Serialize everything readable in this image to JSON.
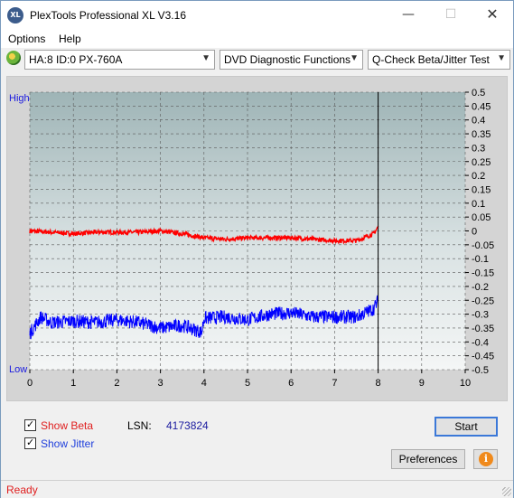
{
  "window": {
    "title": "PlexTools Professional XL V3.16",
    "icon": "XL"
  },
  "controls": {
    "minimize": "—",
    "maximize": "☐",
    "close": "✕"
  },
  "menu": {
    "options": "Options",
    "help": "Help"
  },
  "toolbar": {
    "drive": "HA:8 ID:0  PX-760A",
    "function": "DVD Diagnostic Functions",
    "test": "Q-Check Beta/Jitter Test"
  },
  "chart_data": {
    "type": "line",
    "left_labels": {
      "high": "High",
      "low": "Low"
    },
    "x_ticks": [
      "0",
      "1",
      "2",
      "3",
      "4",
      "5",
      "6",
      "7",
      "8",
      "9",
      "10"
    ],
    "xlim": [
      0,
      10
    ],
    "y_ticks_right": [
      "0.5",
      "0.45",
      "0.4",
      "0.35",
      "0.3",
      "0.25",
      "0.2",
      "0.15",
      "0.1",
      "0.05",
      "0",
      "-0.05",
      "-0.1",
      "-0.15",
      "-0.2",
      "-0.25",
      "-0.3",
      "-0.35",
      "-0.4",
      "-0.45",
      "-0.5"
    ],
    "ylim": [
      -0.5,
      0.5
    ],
    "grid": true,
    "marker_x": 8.0,
    "series": [
      {
        "color": "#ff0000",
        "band": 0.008,
        "x": [
          0,
          0.5,
          1,
          1.5,
          2,
          2.5,
          3,
          3.5,
          4,
          4.5,
          5,
          5.5,
          6,
          6.5,
          7,
          7.5,
          7.9,
          8.0
        ],
        "y": [
          0.0,
          -0.005,
          -0.01,
          -0.005,
          -0.005,
          -0.005,
          0.0,
          -0.01,
          -0.025,
          -0.03,
          -0.025,
          -0.025,
          -0.025,
          -0.03,
          -0.035,
          -0.035,
          -0.01,
          0.015
        ]
      },
      {
        "color": "#0000ff",
        "band": 0.025,
        "x": [
          0,
          0.25,
          0.5,
          1,
          1.5,
          2,
          2.5,
          3,
          3.5,
          3.95,
          4.0,
          4.5,
          5,
          5.5,
          6,
          6.5,
          7,
          7.5,
          7.9,
          8.0
        ],
        "y": [
          -0.37,
          -0.31,
          -0.33,
          -0.325,
          -0.33,
          -0.32,
          -0.33,
          -0.35,
          -0.34,
          -0.365,
          -0.315,
          -0.31,
          -0.32,
          -0.3,
          -0.295,
          -0.31,
          -0.31,
          -0.31,
          -0.28,
          -0.25
        ]
      }
    ]
  },
  "options": {
    "show_beta": "Show Beta",
    "show_jitter": "Show Jitter",
    "lsn_label": "LSN:",
    "lsn_value": "4173824",
    "start": "Start",
    "preferences": "Preferences",
    "info": "i"
  },
  "status": "Ready"
}
